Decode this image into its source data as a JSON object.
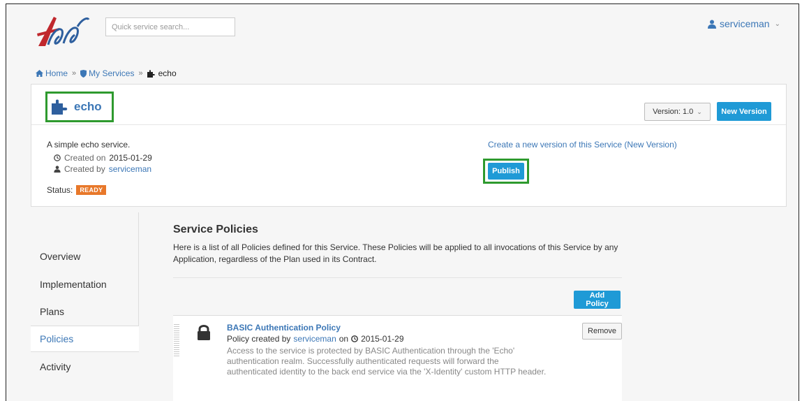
{
  "header": {
    "search_placeholder": "Quick service search...",
    "user_name": "serviceman"
  },
  "breadcrumb": {
    "home": "Home",
    "sep": "»",
    "my_services": "My Services",
    "current": "echo"
  },
  "service": {
    "name": "echo",
    "version_label": "Version: 1.0",
    "new_version_label": "New Version",
    "description": "A simple echo service.",
    "created_on_label": "Created on",
    "created_on_date": "2015-01-29",
    "created_by_label": "Created by",
    "created_by_user": "serviceman",
    "status_label": "Status:",
    "status_value": "READY",
    "create_version_link": "Create a new version of this Service (New Version)",
    "publish_label": "Publish"
  },
  "nav": {
    "items": [
      {
        "label": "Overview"
      },
      {
        "label": "Implementation"
      },
      {
        "label": "Plans"
      },
      {
        "label": "Policies"
      },
      {
        "label": "Activity"
      }
    ],
    "active_index": 3
  },
  "policies": {
    "title": "Service Policies",
    "description": "Here is a list of all Policies defined for this Service. These Policies will be applied to all invocations of this Service by any Application, regardless of the Plan used in its Contract.",
    "add_label": "Add Policy",
    "items": [
      {
        "name": "BASIC Authentication Policy",
        "created_prefix": "Policy created by",
        "created_by": "serviceman",
        "on_label": "on",
        "date": "2015-01-29",
        "description": "Access to the service is protected by BASIC Authentication through the 'Echo' authentication realm. Successfully authenticated requests will forward the authenticated identity to the back end service via the 'X-Identity' custom HTTP header.",
        "remove_label": "Remove"
      }
    ]
  },
  "colors": {
    "accent": "#1f9ad6",
    "link": "#3c77b6",
    "status_ready": "#e8782a",
    "highlight": "#2e9a2e"
  }
}
